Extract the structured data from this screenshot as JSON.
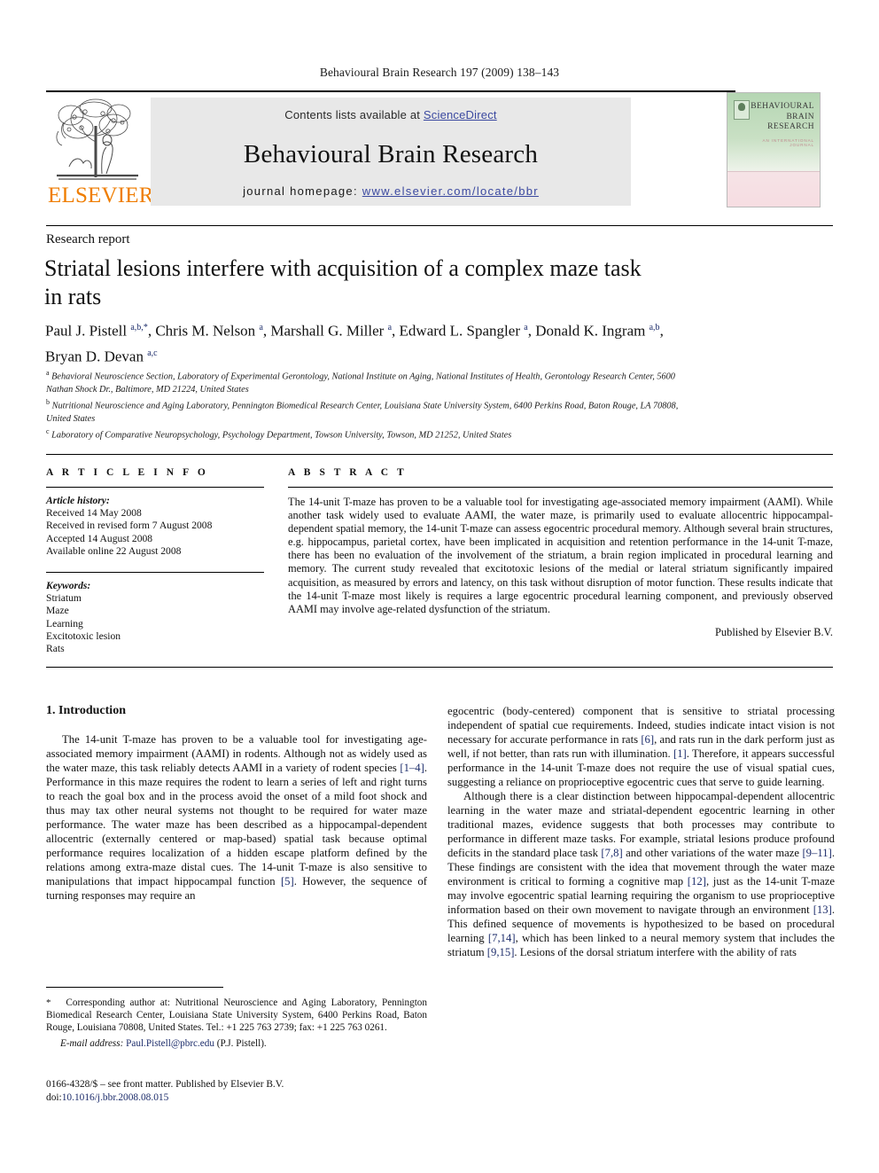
{
  "running_head": "Behavioural Brain Research 197 (2009) 138–143",
  "masthead": {
    "contents_prefix": "Contents lists available at ",
    "sciencedirect": "ScienceDirect",
    "journal_title": "Behavioural Brain Research",
    "homepage_prefix": "journal homepage:",
    "homepage_url": "www.elsevier.com/locate/bbr",
    "publisher_wordmark": "ELSEVIER",
    "cover": {
      "line1": "BEHAVIOURAL",
      "line2": "BRAIN",
      "line3": "RESEARCH",
      "subtitle": "AN INTERNATIONAL JOURNAL"
    }
  },
  "article": {
    "type": "Research report",
    "title": "Striatal lesions interfere with acquisition of a complex maze task in rats",
    "authors_html": "Paul J. Pistell <sup>a,b,<span class=\"star\">*</span></sup>, Chris M. Nelson <sup>a</sup>, Marshall G. Miller <sup>a</sup>, Edward L. Spangler <sup>a</sup>, Donald K. Ingram <sup>a,b</sup>, Bryan D. Devan <sup>a,c</sup>",
    "affiliations": [
      {
        "marker": "a",
        "text": "Behavioral Neuroscience Section, Laboratory of Experimental Gerontology, National Institute on Aging, National Institutes of Health, Gerontology Research Center, 5600 Nathan Shock Dr., Baltimore, MD 21224, United States"
      },
      {
        "marker": "b",
        "text": "Nutritional Neuroscience and Aging Laboratory, Pennington Biomedical Research Center, Louisiana State University System, 6400 Perkins Road, Baton Rouge, LA 70808, United States"
      },
      {
        "marker": "c",
        "text": "Laboratory of Comparative Neuropsychology, Psychology Department, Towson University, Towson, MD 21252, United States"
      }
    ]
  },
  "article_info": {
    "heading": "A R T I C L E    I N F O",
    "history_label": "Article history:",
    "history": [
      "Received 14 May 2008",
      "Received in revised form 7 August 2008",
      "Accepted 14 August 2008",
      "Available online 22 August 2008"
    ],
    "keywords_label": "Keywords:",
    "keywords": [
      "Striatum",
      "Maze",
      "Learning",
      "Excitotoxic lesion",
      "Rats"
    ]
  },
  "abstract": {
    "heading": "A B S T R A C T",
    "text": "The 14-unit T-maze has proven to be a valuable tool for investigating age-associated memory impairment (AAMI). While another task widely used to evaluate AAMI, the water maze, is primarily used to evaluate allocentric hippocampal-dependent spatial memory, the 14-unit T-maze can assess egocentric procedural memory. Although several brain structures, e.g. hippocampus, parietal cortex, have been implicated in acquisition and retention performance in the 14-unit T-maze, there has been no evaluation of the involvement of the striatum, a brain region implicated in procedural learning and memory. The current study revealed that excitotoxic lesions of the medial or lateral striatum significantly impaired acquisition, as measured by errors and latency, on this task without disruption of motor function. These results indicate that the 14-unit T-maze most likely is requires a large egocentric procedural learning component, and previously observed AAMI may involve age-related dysfunction of the striatum.",
    "publisher": "Published by Elsevier B.V."
  },
  "introduction": {
    "heading": "1.  Introduction",
    "left_para_1_html": "The 14-unit T-maze has proven to be a valuable tool for investigating age-associated memory impairment (AAMI) in rodents. Although not as widely used as the water maze, this task reliably detects AAMI in a variety of rodent species <a class=\"ref\" href=\"#\">[1–4]</a>. Performance in this maze requires the rodent to learn a series of left and right turns to reach the goal box and in the process avoid the onset of a mild foot shock and thus may tax other neural systems not thought to be required for water maze performance. The water maze has been described as a hippocampal-dependent allocentric (externally centered or map-based) spatial task because optimal performance requires localization of a hidden escape platform defined by the relations among extra-maze distal cues. The 14-unit T-maze is also sensitive to manipulations that impact hippocampal function <a class=\"ref\" href=\"#\">[5]</a>. However, the sequence of turning responses may require an",
    "right_para_1_html": "egocentric (body-centered) component that is sensitive to striatal processing independent of spatial cue requirements. Indeed, studies indicate intact vision is not necessary for accurate performance in rats <a class=\"ref\" href=\"#\">[6]</a>, and rats run in the dark perform just as well, if not better, than rats run with illumination. <a class=\"ref\" href=\"#\">[1]</a>. Therefore, it appears successful performance in the 14-unit T-maze does not require the use of visual spatial cues, suggesting a reliance on proprioceptive egocentric cues that serve to guide learning.",
    "right_para_2_html": "Although there is a clear distinction between hippocampal-dependent allocentric learning in the water maze and striatal-dependent egocentric learning in other traditional mazes, evidence suggests that both processes may contribute to performance in different maze tasks. For example, striatal lesions produce profound deficits in the standard place task <a class=\"ref\" href=\"#\">[7,8]</a> and other variations of the water maze <a class=\"ref\" href=\"#\">[9–11]</a>. These findings are consistent with the idea that movement through the water maze environment is critical to forming a cognitive map <a class=\"ref\" href=\"#\">[12]</a>, just as the 14-unit T-maze may involve egocentric spatial learning requiring the organism to use proprioceptive information based on their own movement to navigate through an environment <a class=\"ref\" href=\"#\">[13]</a>. This defined sequence of movements is hypothesized to be based on procedural learning <a class=\"ref\" href=\"#\">[7,14]</a>, which has been linked to a neural memory system that includes the striatum <a class=\"ref\" href=\"#\">[9,15]</a>. Lesions of the dorsal striatum interfere with the ability of rats"
  },
  "footnote": {
    "corresponding_html": "<span class=\"star\">*</span>&nbsp;&nbsp; Corresponding author at: Nutritional Neuroscience and Aging Laboratory, Pennington Biomedical Research Center, Louisiana State University System, 6400 Perkins Road, Baton Rouge, Louisiana 70808, United States. Tel.: +1 225 763 2739; fax: +1 225 763 0261.",
    "email_label": "E-mail address:",
    "email": "Paul.Pistell@pbrc.edu",
    "email_owner": "(P.J. Pistell)."
  },
  "copyright": {
    "issn_line": "0166-4328/$ – see front matter. Published by Elsevier B.V.",
    "doi_label": "doi:",
    "doi": "10.1016/j.bbr.2008.08.015"
  },
  "colors": {
    "link": "#1d2d6b",
    "elsevier_orange": "#ef7d00",
    "band_gray": "#e8e8e8"
  }
}
